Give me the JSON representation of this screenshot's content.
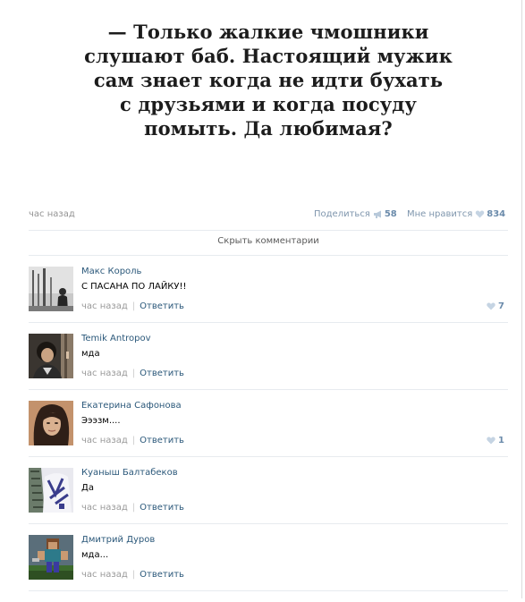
{
  "post": {
    "quote_lines": [
      "— Только жалкие чмошники",
      "слушают баб. Настоящий мужик",
      "сам знает когда не идти бухать",
      "с друзьями и когда посуду",
      "помыть. Да любимая?"
    ],
    "time": "час назад",
    "share_label": "Поделиться",
    "share_count": "58",
    "dislike_label": "Мне нравится",
    "dislike_count": "834"
  },
  "comments_toggle": "Скрыть комментарии",
  "comments": [
    {
      "author": "Макс Король",
      "text": "С ПАСАНА ПО ЛАЙКУ!!",
      "time": "час назад",
      "reply": "Ответить",
      "likes": "7"
    },
    {
      "author": "Temik Antropov",
      "text": "мда",
      "time": "час назад",
      "reply": "Ответить",
      "likes": ""
    },
    {
      "author": "Екатерина Сафонова",
      "text": "Эээзм....",
      "time": "час назад",
      "reply": "Ответить",
      "likes": "1"
    },
    {
      "author": "Куаныш Балтабеков",
      "text": "Да",
      "time": "час назад",
      "reply": "Ответить",
      "likes": ""
    },
    {
      "author": "Дмитрий Дуров",
      "text": "мда...",
      "time": "час назад",
      "reply": "Ответить",
      "likes": ""
    }
  ],
  "colors": {
    "link": "#2b587a",
    "meta": "#939393",
    "accent": "#6b8bab",
    "heart": "#c5d4e3"
  },
  "icons": [
    "megaphone-icon",
    "heart-icon"
  ]
}
